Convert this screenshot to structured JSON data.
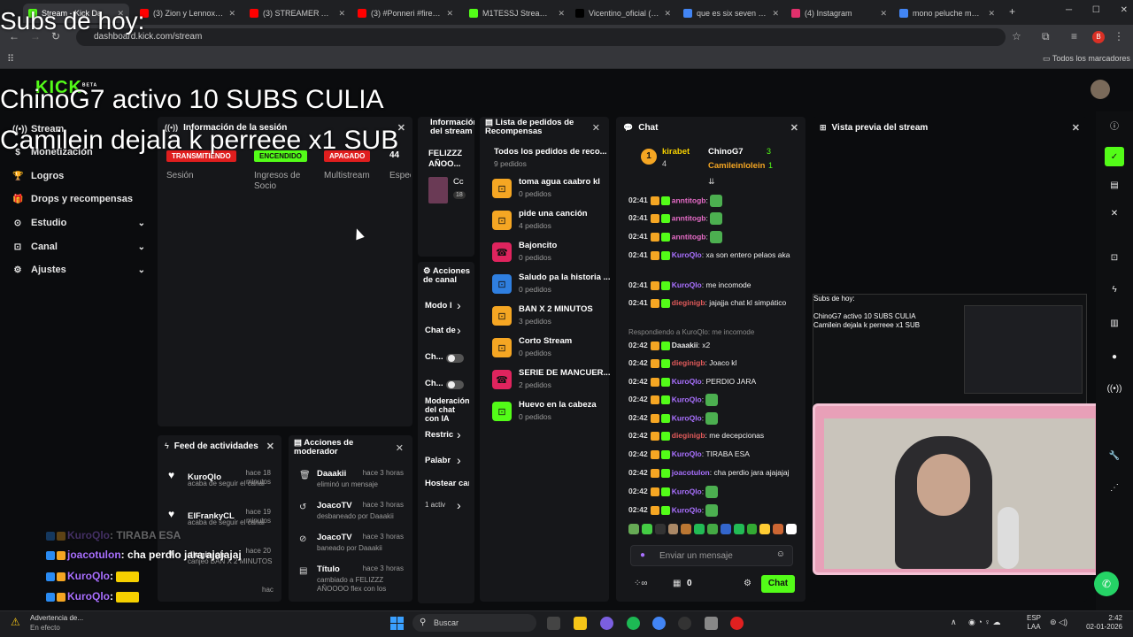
{
  "browser": {
    "tabs": [
      {
        "label": "Stream - Kick Da",
        "color": "#53fc18",
        "active": true
      },
      {
        "label": "(3) Zion y Lennox - H",
        "color": "#ff0000"
      },
      {
        "label": "(3) STREAMER ALCO",
        "color": "#ff0000"
      },
      {
        "label": "(3) #Ponneri #firecra",
        "color": "#ff0000"
      },
      {
        "label": "M1TESSJ Stream - W",
        "color": "#53fc18"
      },
      {
        "label": "Vicentino_oficial (@v",
        "color": "#000000"
      },
      {
        "label": "que es six seven - Go",
        "color": "#4285f4"
      },
      {
        "label": "(4) Instagram",
        "color": "#e1306c"
      },
      {
        "label": "mono peluche mono",
        "color": "#4285f4"
      }
    ],
    "url": "dashboard.kick.com/stream",
    "bookmarks_label": "Todos los marcadores"
  },
  "overlay": {
    "subs_title": "Subs de hoy:",
    "line1": "ChinoG7 activo 10 SUBS CULIA",
    "line2": "Camilein dejala k perreee x1 SUB"
  },
  "kick": {
    "logo": "KICK",
    "logo_sup": "BETA"
  },
  "sidebar": {
    "items": [
      {
        "label": "Stream",
        "icon": "stream-icon"
      },
      {
        "label": "Monetización",
        "icon": "money-icon"
      },
      {
        "label": "Logros",
        "icon": "trophy-icon"
      },
      {
        "label": "Drops y recompensas",
        "icon": "gift-icon"
      },
      {
        "label": "Estudio",
        "icon": "studio-icon",
        "chevron": true
      },
      {
        "label": "Canal",
        "icon": "channel-icon",
        "chevron": true
      },
      {
        "label": "Ajustes",
        "icon": "gear-icon",
        "chevron": true
      }
    ]
  },
  "session": {
    "title": "Información de la sesión",
    "stats": [
      {
        "badge": "TRANSMITIENDO",
        "color": "#e01e1e",
        "label": "Sesión"
      },
      {
        "badge": "ENCENDIDO",
        "color": "#53fc18",
        "label": "Ingresos de Socio"
      },
      {
        "badge": "APAGADO",
        "color": "#e01e1e",
        "label": "Multistream"
      },
      {
        "badge": "44",
        "color": "",
        "label": "Espec"
      }
    ]
  },
  "stream_info": {
    "title": "Información del stream",
    "stream_title": "FELIZZZ AÑOO...",
    "category": "Cc",
    "tag": "18"
  },
  "requests": {
    "title": "Lista de pedidos de Recompensas",
    "all_label": "Todos los pedidos de reco...",
    "all_count": "9 pedidos",
    "items": [
      {
        "title": "toma agua caabro kl",
        "count": "0 pedidos",
        "color": "#f5a623"
      },
      {
        "title": "pide una canción",
        "count": "4 pedidos",
        "color": "#f5a623"
      },
      {
        "title": "Bajoncito",
        "count": "0 pedidos",
        "color": "#e0245e"
      },
      {
        "title": "Saludo pa la historia ...",
        "count": "0 pedidos",
        "color": "#2f7fe0"
      },
      {
        "title": "BAN X 2 MINUTOS",
        "count": "3 pedidos",
        "color": "#f5a623"
      },
      {
        "title": "Corto Stream",
        "count": "0 pedidos",
        "color": "#f5a623"
      },
      {
        "title": "SERIE DE MANCUER...",
        "count": "2 pedidos",
        "color": "#e0245e"
      },
      {
        "title": "Huevo en la cabeza",
        "count": "0 pedidos",
        "color": "#53fc18"
      }
    ]
  },
  "chat": {
    "title": "Chat",
    "top": [
      {
        "name": "kirabet",
        "count": "4"
      },
      {
        "name": "ChinoG7",
        "count": "3"
      },
      {
        "name": "Camileinlolein",
        "count": "1"
      }
    ],
    "messages": [
      {
        "time": "02:41",
        "user": "anntitogb",
        "color": "#e66cc7",
        "text": ""
      },
      {
        "time": "02:41",
        "user": "anntitogb",
        "color": "#e66cc7",
        "text": ""
      },
      {
        "time": "02:41",
        "user": "anntitogb",
        "color": "#e66cc7",
        "text": ""
      },
      {
        "time": "02:41",
        "user": "KuroQlo",
        "color": "#a970ff",
        "text": "xa son entero pelaos aka"
      },
      {
        "time": "02:41",
        "user": "KuroQlo",
        "color": "#a970ff",
        "text": "me incomode"
      },
      {
        "time": "02:41",
        "user": "dieginigb",
        "color": "#e05a5a",
        "text": "jajajja chat kl simpático"
      },
      {
        "time": "",
        "user": "",
        "color": "#888888",
        "text": "Respondiendo a KuroQlo: me incomode"
      },
      {
        "time": "02:42",
        "user": "Daaakii",
        "color": "#e8e8e8",
        "text": "x2"
      },
      {
        "time": "02:42",
        "user": "dieginigb",
        "color": "#e05a5a",
        "text": "Joaco kl"
      },
      {
        "time": "02:42",
        "user": "KuroQlo",
        "color": "#a970ff",
        "text": "PERDIO JARA"
      },
      {
        "time": "02:42",
        "user": "KuroQlo",
        "color": "#a970ff",
        "text": ""
      },
      {
        "time": "02:42",
        "user": "KuroQlo",
        "color": "#a970ff",
        "text": ""
      },
      {
        "time": "02:42",
        "user": "dieginigb",
        "color": "#e05a5a",
        "text": "me decepcionas"
      },
      {
        "time": "02:42",
        "user": "KuroQlo",
        "color": "#a970ff",
        "text": "TIRABA ESA"
      },
      {
        "time": "02:42",
        "user": "joacotulon",
        "color": "#a970ff",
        "text": "cha perdio jara ajajajaj"
      },
      {
        "time": "02:42",
        "user": "KuroQlo",
        "color": "#a970ff",
        "text": ""
      },
      {
        "time": "02:42",
        "user": "KuroQlo",
        "color": "#a970ff",
        "text": ""
      }
    ],
    "placeholder": "Enviar un mensaje",
    "points": "0",
    "send_label": "Chat"
  },
  "preview": {
    "title": "Vista previa del stream",
    "mini_subs": "Subs de hoy:",
    "mini_line1": "ChinoG7 activo 10 SUBS CULIA",
    "mini_line2": "Camilein dejala k perreee x1 SUB"
  },
  "feed": {
    "title": "Feed de actividades",
    "items": [
      {
        "name": "KuroQlo",
        "time": "hace 18 minutos",
        "desc": "acaba de seguir el canal"
      },
      {
        "name": "ElFrankyCL",
        "time": "hace 19 minutos",
        "desc": "acaba de seguir el canal"
      },
      {
        "name": "dieginigb",
        "time": "hace 20",
        "desc": "canjeó BAN X 2 MINUTOS"
      }
    ],
    "extra_time": "hac"
  },
  "mod_actions": {
    "title": "Acciones de moderador",
    "items": [
      {
        "name": "Daaakii",
        "time": "hace 3 horas",
        "desc": "eliminó un mensaje",
        "icon": "trash-icon"
      },
      {
        "name": "JoacoTV",
        "time": "hace 3 horas",
        "desc": "desbaneado por Daaakii",
        "icon": "undo-icon"
      },
      {
        "name": "JoacoTV",
        "time": "hace 3 horas",
        "desc": "baneado por Daaakii",
        "icon": "ban-icon"
      },
      {
        "name": "Título",
        "time": "hace 3 horas",
        "desc": "cambiado a FELIZZZ AÑOOOO flex con los",
        "icon": "title-icon"
      }
    ]
  },
  "channel_actions": {
    "title": "Acciones de canal",
    "items": [
      "Modo l",
      "Chat de",
      "Ch...",
      "Ch...",
      "Moderación del chat con IA",
      "Restric",
      "Palabr",
      "Hostear can",
      "1 activ"
    ]
  },
  "bottom_chat": [
    {
      "user": "KuroQlo",
      "text": "TIRABA ESA"
    },
    {
      "user": "joacotulon",
      "text": "cha perdio jara ajajajaj"
    },
    {
      "user": "KuroQlo",
      "text": ""
    },
    {
      "user": "KuroQlo",
      "text": ""
    }
  ],
  "taskbar": {
    "warning_title": "Advertencia de...",
    "warning_sub": "En efecto",
    "search_placeholder": "Buscar",
    "lang": "ESP",
    "lang2": "LAA",
    "time": "2:42",
    "date": "02-01-2026"
  }
}
